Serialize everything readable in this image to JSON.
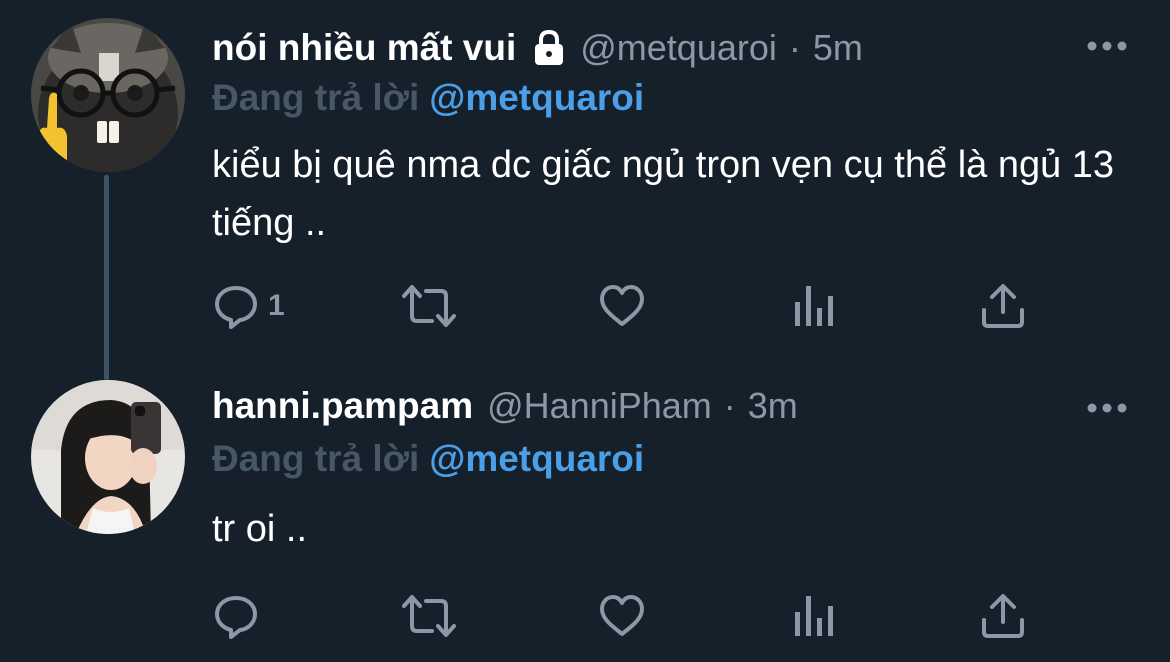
{
  "tweets": [
    {
      "display_name": "nói nhiều mất vui",
      "handle": "@metquaroi",
      "separator": "·",
      "time": "5m",
      "protected_icon": "lock-icon",
      "replying_label": "Đang trả lời",
      "replying_to": "@metquaroi",
      "text": "kiểu bị quê nma dc giấc ngủ trọn vẹn cụ thể là ngủ 13 tiếng ..",
      "reply_count": "1",
      "actions": [
        "reply-icon",
        "retweet-icon",
        "like-icon",
        "analytics-icon",
        "share-icon"
      ],
      "more_icon": "more-icon"
    },
    {
      "display_name": "hanni.pampam",
      "handle": "@HanniPham",
      "separator": "·",
      "time": "3m",
      "replying_label": "Đang trả lời",
      "replying_to": "@metquaroi",
      "text": "tr oi ..",
      "reply_count": "",
      "actions": [
        "reply-icon",
        "retweet-icon",
        "like-icon",
        "analytics-icon",
        "share-icon"
      ],
      "more_icon": "more-icon"
    }
  ],
  "colors": {
    "background": "#15202b",
    "text_primary": "#ffffff",
    "text_secondary": "#8b98a5",
    "mention": "#4a9fe8",
    "thread_line": "#3d5466"
  }
}
